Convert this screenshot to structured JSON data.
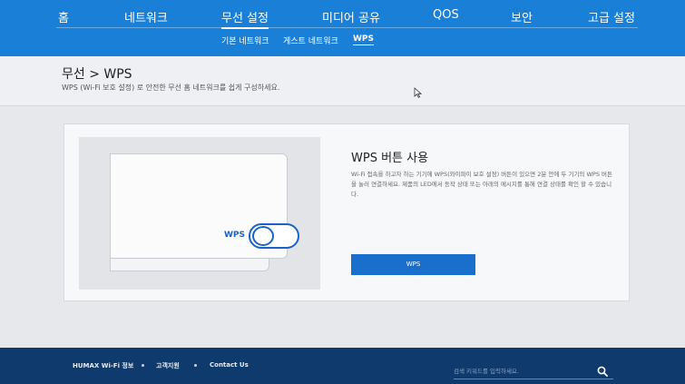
{
  "main_menu": {
    "items": [
      {
        "label": "홈"
      },
      {
        "label": "네트워크"
      },
      {
        "label": "무선 설정"
      },
      {
        "label": "미디어 공유"
      },
      {
        "label": "QOS"
      },
      {
        "label": "보안"
      },
      {
        "label": "고급 설정"
      }
    ],
    "active_index": 2
  },
  "sub_menu": {
    "items": [
      {
        "label": "기본 네트워크"
      },
      {
        "label": "게스트 네트워크"
      },
      {
        "label": "WPS"
      }
    ],
    "active_index": 2
  },
  "page": {
    "title": "무선 > WPS",
    "description": "WPS (Wi-Fi 보호 설정) 로 안전한 무선 홈 네트워크를 쉽게 구성하세요."
  },
  "wps_card": {
    "illustration_label": "WPS",
    "title": "WPS 버튼 사용",
    "description": "Wi-Fi 접속을 하고자 하는 기기에 WPS(와이파이 보호 설정) 버튼이 있으면 2분 안에 두 기기의 WPS 버튼을 눌러 연결하세요. 제품의 LED에서 동작 상태 또는 아래의 메시지를 통해 연결 상태를 확인 할 수 있습니다.",
    "button_label": "WPS"
  },
  "footer": {
    "links": [
      {
        "label": "HUMAX Wi-Fi 정보"
      },
      {
        "label": "고객지원"
      },
      {
        "label": "Contact Us"
      }
    ],
    "search_placeholder": "검색 키워드를 입력하세요."
  },
  "colors": {
    "nav_blue": "#1a7fd6",
    "button_blue": "#1a6fcc",
    "footer_navy": "#0e3a6e",
    "toggle_blue": "#1a63c6"
  },
  "icons": {
    "search": "search-icon",
    "cursor": "mouse-pointer-icon"
  }
}
